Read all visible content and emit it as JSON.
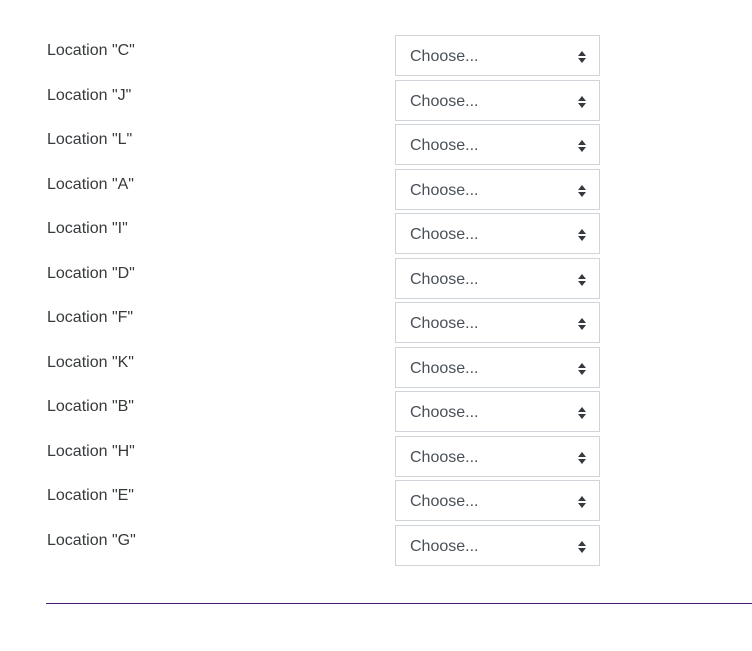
{
  "form": {
    "rows": [
      {
        "label": "Location \"C\"",
        "value": "Choose..."
      },
      {
        "label": "Location \"J\"",
        "value": "Choose..."
      },
      {
        "label": "Location \"L\"",
        "value": "Choose..."
      },
      {
        "label": "Location \"A\"",
        "value": "Choose..."
      },
      {
        "label": "Location \"I\"",
        "value": "Choose..."
      },
      {
        "label": "Location \"D\"",
        "value": "Choose..."
      },
      {
        "label": "Location \"F\"",
        "value": "Choose..."
      },
      {
        "label": "Location \"K\"",
        "value": "Choose..."
      },
      {
        "label": "Location \"B\"",
        "value": "Choose..."
      },
      {
        "label": "Location \"H\"",
        "value": "Choose..."
      },
      {
        "label": "Location \"E\"",
        "value": "Choose..."
      },
      {
        "label": "Location \"G\"",
        "value": "Choose..."
      }
    ],
    "select_icon": "up-down-arrows-icon"
  },
  "colors": {
    "divider": "#4a1a6e",
    "select_border": "#ced4da",
    "label_text": "#373a3c"
  }
}
